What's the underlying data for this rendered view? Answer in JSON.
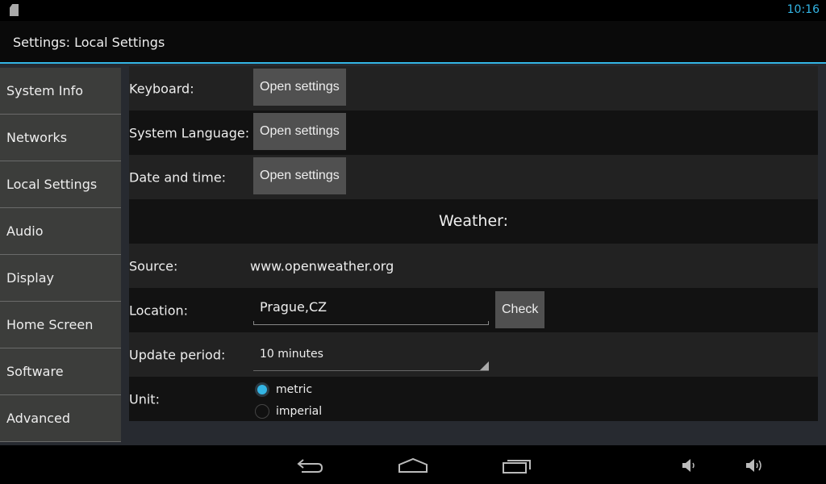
{
  "status_bar": {
    "time": "10:16",
    "icons": [
      "sd-card-icon"
    ]
  },
  "title": "Settings: Local Settings",
  "sidebar": {
    "items": [
      {
        "label": "System Info"
      },
      {
        "label": "Networks"
      },
      {
        "label": "Local Settings"
      },
      {
        "label": "Audio"
      },
      {
        "label": "Display"
      },
      {
        "label": "Home Screen"
      },
      {
        "label": "Software"
      },
      {
        "label": "Advanced"
      }
    ]
  },
  "rows": {
    "keyboard": {
      "label": "Keyboard:",
      "button": "Open settings"
    },
    "language": {
      "label": "System Language:",
      "button": "Open settings"
    },
    "datetime": {
      "label": "Date and time:",
      "button": "Open settings"
    },
    "weather_header": "Weather:",
    "source": {
      "label": "Source:",
      "value": "www.openweather.org"
    },
    "location": {
      "label": "Location:",
      "value": "Prague,CZ",
      "button": "Check"
    },
    "update": {
      "label": "Update period:",
      "value": "10 minutes"
    },
    "unit": {
      "label": "Unit:",
      "options": [
        "metric",
        "imperial"
      ],
      "selected": "metric"
    }
  },
  "colors": {
    "accent": "#33b5e5"
  }
}
